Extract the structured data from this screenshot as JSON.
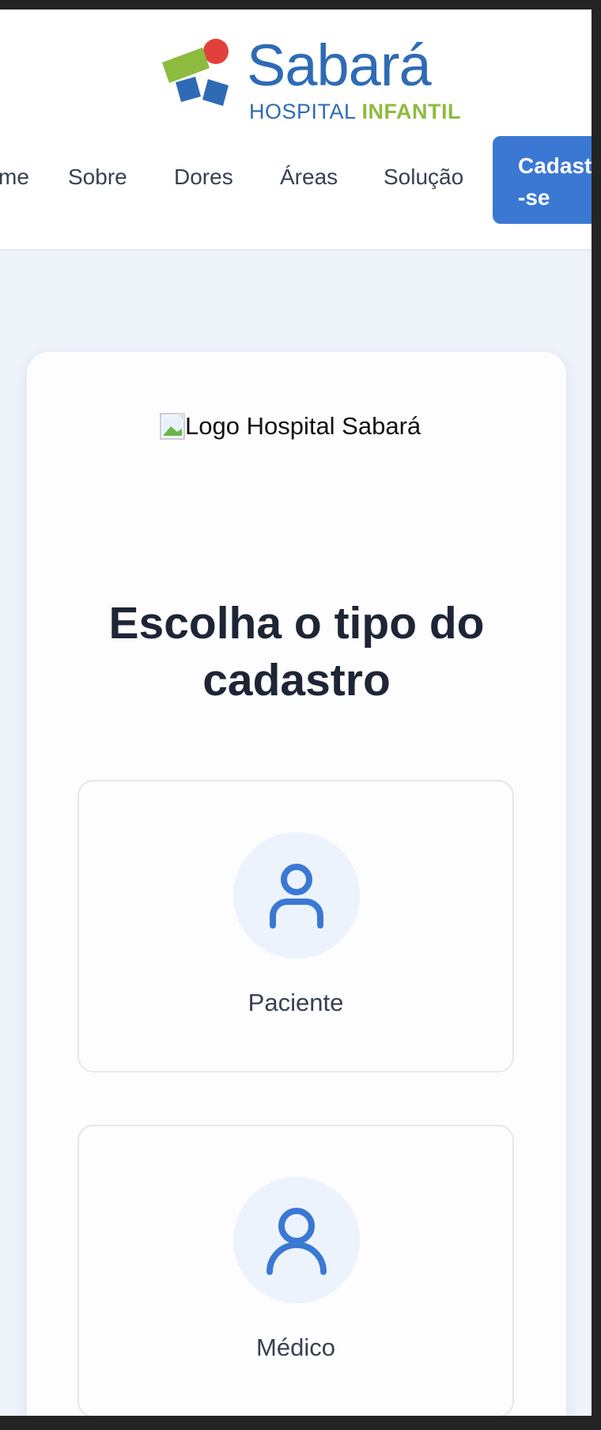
{
  "brand": {
    "name": "Sabará",
    "subtitle_a": "HOSPITAL",
    "subtitle_b": "INFANTIL",
    "colors": {
      "blue": "#2f6bb5",
      "green": "#8dbb40",
      "red": "#e2403b"
    }
  },
  "nav": {
    "items": [
      {
        "label": "me"
      },
      {
        "label": "Sobre"
      },
      {
        "label": "Dores"
      },
      {
        "label": "Áreas"
      },
      {
        "label": "Solução"
      }
    ],
    "cta_label": "Cadastre-se"
  },
  "card": {
    "logo_alt": "Logo Hospital Sabará",
    "title": "Escolha o tipo do cadastro",
    "options": [
      {
        "label": "Paciente",
        "icon": "user-icon"
      },
      {
        "label": "Médico",
        "icon": "user-icon"
      }
    ]
  },
  "colors": {
    "accent": "#3a78d4",
    "page_bg": "#eff4fb",
    "title": "#1e2536"
  }
}
